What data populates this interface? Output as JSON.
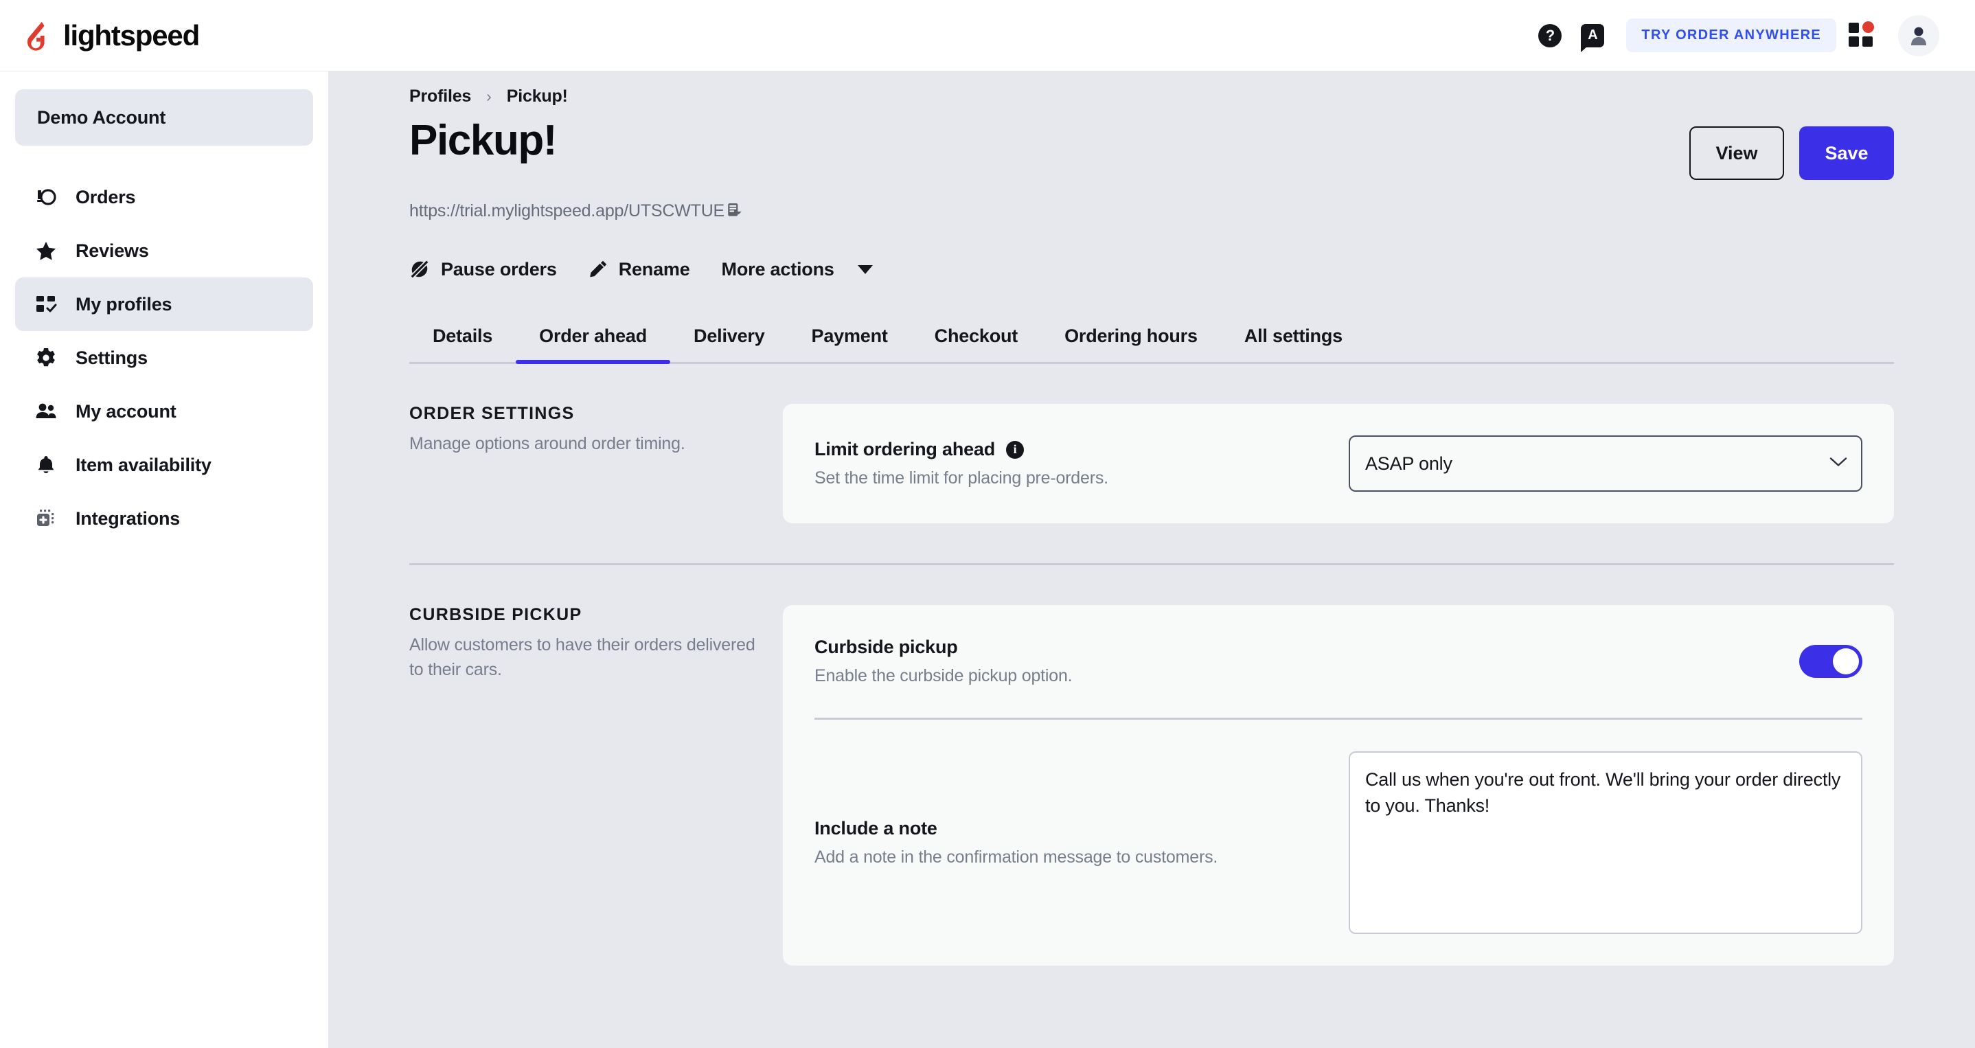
{
  "topbar": {
    "logo_text": "lightspeed",
    "logo_color": "#e03b2f",
    "help_icon_label": "?",
    "announcement_icon_label": "A",
    "try_order_anywhere": "TRY ORDER ANYWHERE",
    "apps_badge_color": "#e03b2f"
  },
  "sidebar": {
    "account_label": "Demo Account",
    "items": [
      {
        "label": "Orders",
        "icon": "orders-icon",
        "active": false
      },
      {
        "label": "Reviews",
        "icon": "star-icon",
        "active": false
      },
      {
        "label": "My profiles",
        "icon": "profiles-grid-icon",
        "active": true
      },
      {
        "label": "Settings",
        "icon": "gear-icon",
        "active": false
      },
      {
        "label": "My account",
        "icon": "users-icon",
        "active": false
      },
      {
        "label": "Item availability",
        "icon": "bell-icon",
        "active": false
      },
      {
        "label": "Integrations",
        "icon": "integrations-plug-icon",
        "active": false
      }
    ]
  },
  "breadcrumb": {
    "parent": "Profiles",
    "separator": "›",
    "current": "Pickup!"
  },
  "page": {
    "title": "Pickup!",
    "url": "https://trial.mylightspeed.app/UTSCWTUE",
    "view_button": "View",
    "save_button": "Save",
    "accent_color": "#3b30e8"
  },
  "action_bar": {
    "pause_orders": "Pause orders",
    "rename": "Rename",
    "more_actions": "More actions"
  },
  "tabs": [
    {
      "label": "Details",
      "active": false
    },
    {
      "label": "Order ahead",
      "active": true
    },
    {
      "label": "Delivery",
      "active": false
    },
    {
      "label": "Payment",
      "active": false
    },
    {
      "label": "Checkout",
      "active": false
    },
    {
      "label": "Ordering hours",
      "active": false
    },
    {
      "label": "All settings",
      "active": false
    }
  ],
  "order_settings": {
    "kicker": "ORDER SETTINGS",
    "description": "Manage options around order timing.",
    "limit": {
      "label": "Limit ordering ahead",
      "sub": "Set the time limit for placing pre-orders.",
      "info_glyph": "i",
      "selected": "ASAP only",
      "options": [
        "ASAP only"
      ]
    }
  },
  "curbside": {
    "kicker": "CURBSIDE PICKUP",
    "description": "Allow customers to have their orders delivered to their cars.",
    "toggle_row": {
      "label": "Curbside pickup",
      "sub": "Enable the curbside pickup option.",
      "enabled": true
    },
    "note_row": {
      "label": "Include a note",
      "sub": "Add a note in the confirmation message to customers.",
      "value": "Call us when you're out front. We'll bring your order directly to you. Thanks!"
    }
  }
}
